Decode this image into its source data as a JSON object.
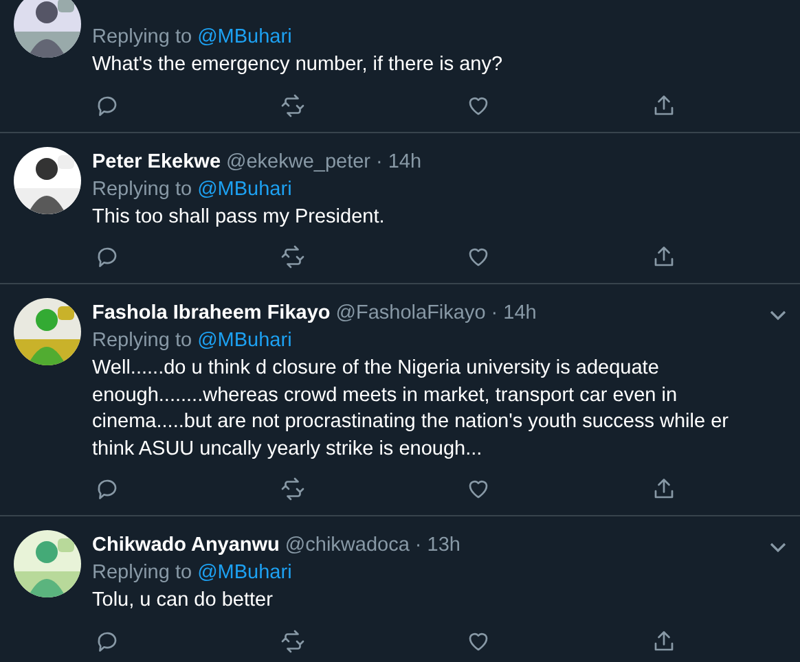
{
  "tweets": [
    {
      "replying_label": "Replying to",
      "reply_to": "@MBuhari",
      "text": "What's the emergency number, if there is any?",
      "menu_shown": false
    },
    {
      "name": "Peter Ekekwe",
      "handle": "@ekekwe_peter",
      "separator": "·",
      "time": "14h",
      "replying_label": "Replying to",
      "reply_to": "@MBuhari",
      "text": "This too shall pass my President.",
      "menu_shown": false
    },
    {
      "name": "Fashola Ibraheem Fikayo",
      "handle": "@FasholaFikayo",
      "separator": "·",
      "time": "14h",
      "replying_label": "Replying to",
      "reply_to": "@MBuhari",
      "text": "Well......do u think d closure of the Nigeria university is adequate enough........whereas crowd meets in market, transport car even in cinema.....but are not procrastinating the nation's youth success while er think ASUU uncally yearly strike is enough...",
      "menu_shown": true
    },
    {
      "name": "Chikwado Anyanwu",
      "handle": "@chikwadoca",
      "separator": "·",
      "time": "13h",
      "replying_label": "Replying to",
      "reply_to": "@MBuhari",
      "text": "Tolu, u can do better",
      "menu_shown": true
    }
  ]
}
